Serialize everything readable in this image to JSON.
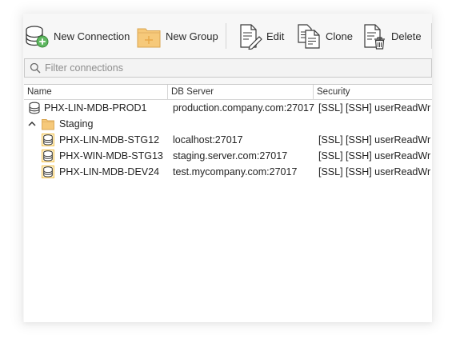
{
  "toolbar": {
    "new_connection": "New Connection",
    "new_group": "New Group",
    "edit": "Edit",
    "clone": "Clone",
    "delete": "Delete"
  },
  "filter": {
    "placeholder": "Filter connections",
    "value": ""
  },
  "columns": [
    "Name",
    "DB Server",
    "Security"
  ],
  "rows": [
    {
      "type": "connection",
      "name": "PHX-LIN-MDB-PROD1",
      "server": "production.company.com:27017",
      "security": "[SSL] [SSH] userReadWri..."
    },
    {
      "type": "group",
      "name": "Staging",
      "expanded": true
    },
    {
      "type": "connection",
      "name": "PHX-LIN-MDB-STG12",
      "server": "localhost:27017",
      "security": "[SSL] [SSH] userReadWri..."
    },
    {
      "type": "connection",
      "name": "PHX-WIN-MDB-STG13",
      "server": "staging.server.com:27017",
      "security": "[SSL] [SSH] userReadWri..."
    },
    {
      "type": "connection",
      "name": "PHX-LIN-MDB-DEV24",
      "server": "test.mycompany.com:27017",
      "security": "[SSL] [SSH] userReadWri..."
    }
  ],
  "icons": {
    "new_connection": "database-add-icon",
    "new_group": "folder-add-icon",
    "edit": "document-edit-icon",
    "clone": "document-clone-icon",
    "delete": "document-delete-icon",
    "filter": "search-icon",
    "group_toggle": "chevron-up-icon",
    "group": "folder-icon",
    "connection": "database-icon"
  },
  "colors": {
    "accent_green": "#5fb760",
    "folder": "#f6c97a",
    "group_highlight": "#f2c14e"
  }
}
